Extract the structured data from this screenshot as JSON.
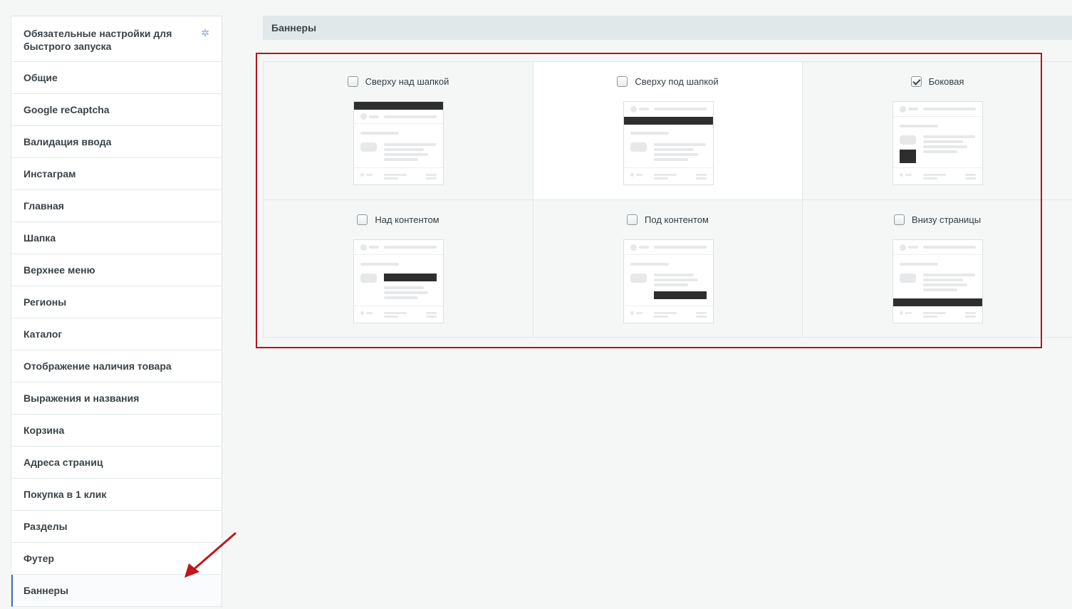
{
  "sidebar": {
    "items": [
      {
        "label": "Обязательные настройки для быстрого запуска",
        "icon": "star-icon",
        "active": false
      },
      {
        "label": "Общие",
        "active": false
      },
      {
        "label": "Google reCaptcha",
        "active": false
      },
      {
        "label": "Валидация ввода",
        "active": false
      },
      {
        "label": "Инстаграм",
        "active": false
      },
      {
        "label": "Главная",
        "active": false
      },
      {
        "label": "Шапка",
        "active": false
      },
      {
        "label": "Верхнее меню",
        "active": false
      },
      {
        "label": "Регионы",
        "active": false
      },
      {
        "label": "Каталог",
        "active": false
      },
      {
        "label": "Отображение наличия товара",
        "active": false
      },
      {
        "label": "Выражения и названия",
        "active": false
      },
      {
        "label": "Корзина",
        "active": false
      },
      {
        "label": "Адреса страниц",
        "active": false
      },
      {
        "label": "Покупка в 1 клик",
        "active": false
      },
      {
        "label": "Разделы",
        "active": false
      },
      {
        "label": "Футер",
        "active": false
      },
      {
        "label": "Баннеры",
        "active": true
      }
    ]
  },
  "main": {
    "section_title": "Баннеры",
    "options": [
      {
        "label": "Сверху над шапкой",
        "checked": false,
        "banner_position": "top-above-header"
      },
      {
        "label": "Сверху под шапкой",
        "checked": false,
        "banner_position": "top-below-header"
      },
      {
        "label": "Боковая",
        "checked": true,
        "banner_position": "side"
      },
      {
        "label": "Над контентом",
        "checked": false,
        "banner_position": "above-content"
      },
      {
        "label": "Под контентом",
        "checked": false,
        "banner_position": "below-content"
      },
      {
        "label": "Внизу страницы",
        "checked": false,
        "banner_position": "page-bottom"
      }
    ]
  },
  "colors": {
    "highlight_frame": "#b3151b",
    "arrow": "#c0161c",
    "active_item_border": "#4a6fa5",
    "banner_block": "#2e2e2e",
    "header_bar": "#e0e8e9"
  }
}
